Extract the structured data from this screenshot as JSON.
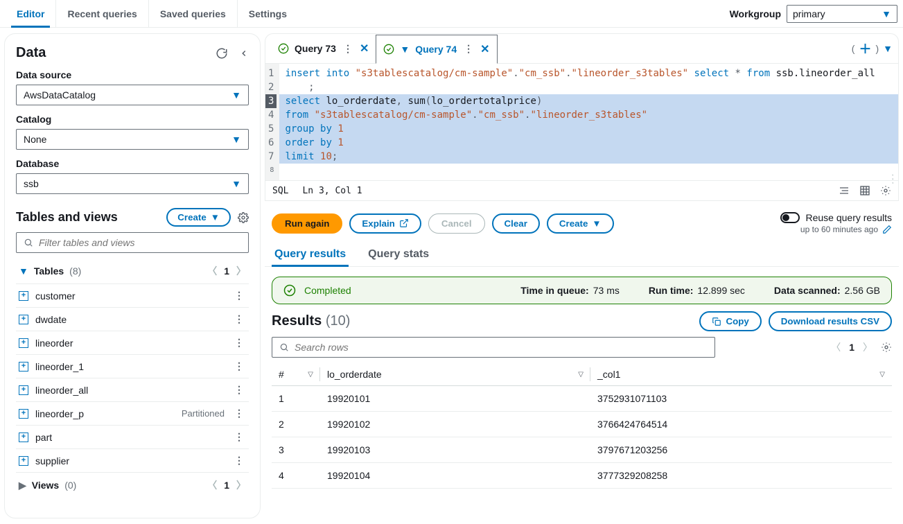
{
  "topnav": {
    "tabs": [
      "Editor",
      "Recent queries",
      "Saved queries",
      "Settings"
    ],
    "workgroup_label": "Workgroup",
    "workgroup_value": "primary"
  },
  "sidebar": {
    "title": "Data",
    "data_source_label": "Data source",
    "data_source_value": "AwsDataCatalog",
    "catalog_label": "Catalog",
    "catalog_value": "None",
    "database_label": "Database",
    "database_value": "ssb",
    "tables_views_title": "Tables and views",
    "create_label": "Create",
    "filter_placeholder": "Filter tables and views",
    "tables_header": "Tables",
    "tables_count": "(8)",
    "tables_page": "1",
    "tables": [
      {
        "name": "customer",
        "tag": ""
      },
      {
        "name": "dwdate",
        "tag": ""
      },
      {
        "name": "lineorder",
        "tag": ""
      },
      {
        "name": "lineorder_1",
        "tag": ""
      },
      {
        "name": "lineorder_all",
        "tag": ""
      },
      {
        "name": "lineorder_p",
        "tag": "Partitioned"
      },
      {
        "name": "part",
        "tag": ""
      },
      {
        "name": "supplier",
        "tag": ""
      }
    ],
    "views_header": "Views",
    "views_count": "(0)",
    "views_page": "1"
  },
  "tabs": {
    "items": [
      "Query 73",
      "Query 74"
    ]
  },
  "editor": {
    "status_lang": "SQL",
    "status_pos": "Ln 3, Col 1"
  },
  "actions": {
    "run": "Run again",
    "explain": "Explain",
    "cancel": "Cancel",
    "clear": "Clear",
    "create": "Create",
    "reuse_label": "Reuse query results",
    "reuse_sub": "up to 60 minutes ago"
  },
  "results_tabs": {
    "results": "Query results",
    "stats": "Query stats"
  },
  "status": {
    "label": "Completed",
    "queue_k": "Time in queue:",
    "queue_v": "73 ms",
    "runtime_k": "Run time:",
    "runtime_v": "12.899 sec",
    "scanned_k": "Data scanned:",
    "scanned_v": "2.56 GB"
  },
  "results": {
    "title": "Results",
    "count": "(10)",
    "copy": "Copy",
    "download": "Download results CSV",
    "search_placeholder": "Search rows",
    "page": "1",
    "columns": [
      "#",
      "lo_orderdate",
      "_col1"
    ],
    "rows": [
      [
        "1",
        "19920101",
        "3752931071103"
      ],
      [
        "2",
        "19920102",
        "3766424764514"
      ],
      [
        "3",
        "19920103",
        "3797671203256"
      ],
      [
        "4",
        "19920104",
        "3777329208258"
      ]
    ]
  }
}
